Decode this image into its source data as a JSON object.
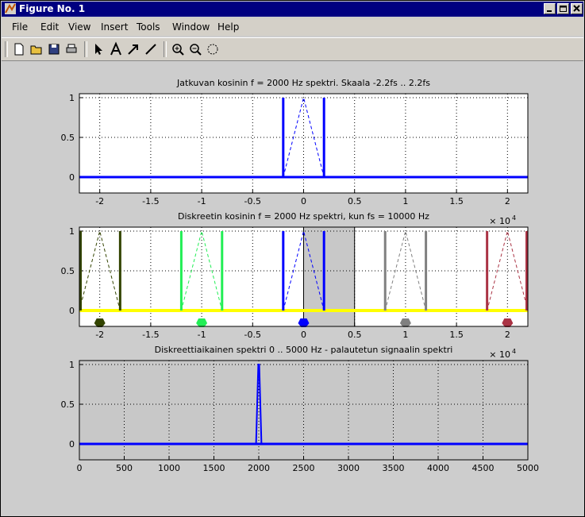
{
  "window": {
    "title": "Figure No. 1",
    "buttons": [
      "minimize",
      "maximize",
      "close"
    ]
  },
  "menu": [
    "File",
    "Edit",
    "View",
    "Insert",
    "Tools",
    "Window",
    "Help"
  ],
  "toolbar": [
    "new-figure-icon",
    "open-folder-icon",
    "save-icon",
    "print-icon",
    "arrow-pointer-icon",
    "text-icon",
    "arrow-icon",
    "line-icon",
    "zoom-in-icon",
    "zoom-out-icon",
    "rotate-icon"
  ],
  "colors": {
    "blue": "#0000ff",
    "yellow": "#ffff00",
    "darkgreen": "#334400",
    "green": "#22ee55",
    "gray": "#808080",
    "red": "#aa3344",
    "shade": "#c8c8c8"
  },
  "chart_data": [
    {
      "type": "line",
      "title": "Jatkuvan kosinin f = 2000 Hz spektri. Skaala -2.2fs .. 2.2fs",
      "xlim": [
        -2.2,
        2.2
      ],
      "ylim": [
        -0.2,
        1.05
      ],
      "xticks": [
        "-2",
        "-1.5",
        "-1",
        "-0.5",
        "0",
        "0.5",
        "1",
        "1.5",
        "2"
      ],
      "yticks": [
        "0",
        "0.5",
        "1"
      ],
      "grid": true,
      "impulses": [
        {
          "x": -0.2,
          "y": 1
        },
        {
          "x": 0.2,
          "y": 1
        }
      ],
      "dashed_triangle": {
        "left": -0.2,
        "peak": 0,
        "right": 0.2,
        "height": 1
      }
    },
    {
      "type": "line",
      "title": "Diskreetin kosinin f = 2000 Hz spektri, kun fs = 10000 Hz",
      "xlim": [
        -2.2,
        2.2
      ],
      "ylim": [
        -0.2,
        1.05
      ],
      "xticks": [
        "-2",
        "-1.5",
        "-1",
        "-0.5",
        "0",
        "0.5",
        "1",
        "1.5",
        "2"
      ],
      "yticks": [
        "0",
        "0.5",
        "1"
      ],
      "exponent": "× 10",
      "exponent_power": "4",
      "grid": true,
      "shaded_region": [
        0,
        0.5
      ],
      "images": [
        {
          "center": -2,
          "color": "darkgreen"
        },
        {
          "center": -1,
          "color": "green"
        },
        {
          "center": 0,
          "color": "blue"
        },
        {
          "center": 1,
          "color": "gray"
        },
        {
          "center": 2,
          "color": "red"
        }
      ],
      "offset": 0.2
    },
    {
      "type": "line",
      "title": "Diskreettiaikainen spektri 0 .. 5000 Hz - palautetun signaalin spektri",
      "xlim": [
        0,
        5000
      ],
      "ylim": [
        -0.2,
        1.05
      ],
      "xticks": [
        "0",
        "500",
        "1000",
        "1500",
        "2000",
        "2500",
        "3000",
        "3500",
        "4000",
        "4500",
        "5000"
      ],
      "yticks": [
        "0",
        "0.5",
        "1"
      ],
      "exponent": "× 10",
      "exponent_power": "4",
      "grid": true,
      "peak": {
        "x": 2000,
        "y": 1
      }
    }
  ]
}
